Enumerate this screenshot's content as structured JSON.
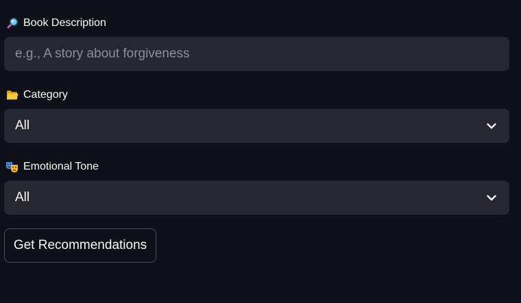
{
  "form": {
    "description": {
      "label": "Book Description",
      "icon": "magnifying-glass-icon",
      "value": "",
      "placeholder": "e.g., A story about forgiveness"
    },
    "category": {
      "label": "Category",
      "icon": "folder-icon",
      "selected": "All"
    },
    "tone": {
      "label": "Emotional Tone",
      "icon": "theater-masks-icon",
      "selected": "All"
    },
    "submit_label": "Get Recommendations"
  },
  "colors": {
    "background": "#0e1117",
    "input_background": "#262730",
    "text": "#fafafa",
    "placeholder": "#8e9099",
    "button_border": "#4a4c57"
  }
}
